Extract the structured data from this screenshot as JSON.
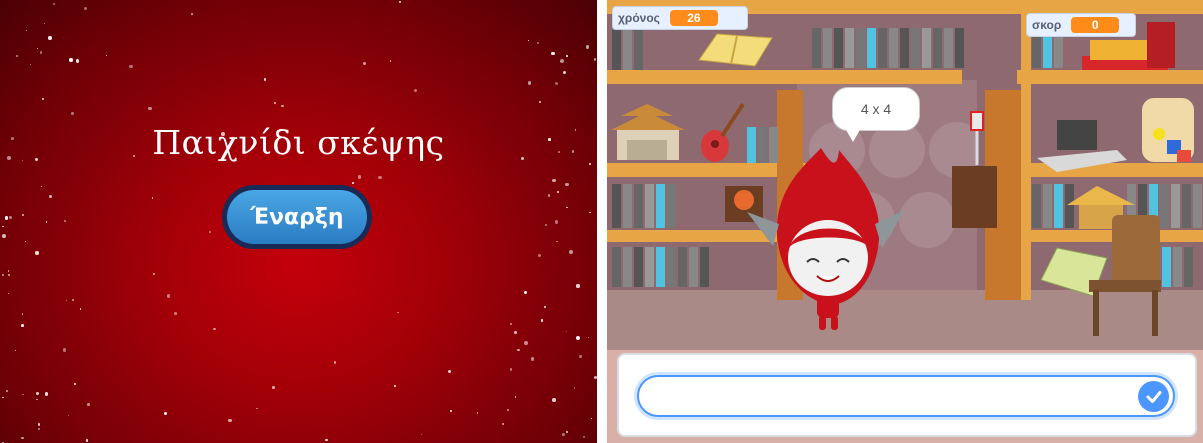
{
  "title_stage": {
    "title": "Παιχνίδι σκέψης",
    "start_label": "Έναρξη"
  },
  "game_stage": {
    "timer_monitor": {
      "label": "χρόνος",
      "value": "26"
    },
    "score_monitor": {
      "label": "σκορ",
      "value": "0"
    },
    "speech_bubble": "4 x 4",
    "answer": {
      "value": "",
      "placeholder": ""
    },
    "icons": {
      "submit": "checkmark-icon"
    }
  },
  "colors": {
    "title_bg": "#b0000a",
    "button": "#2f86cc",
    "monitor_value": "#ff8c1a",
    "input_accent": "#4c97ff"
  }
}
